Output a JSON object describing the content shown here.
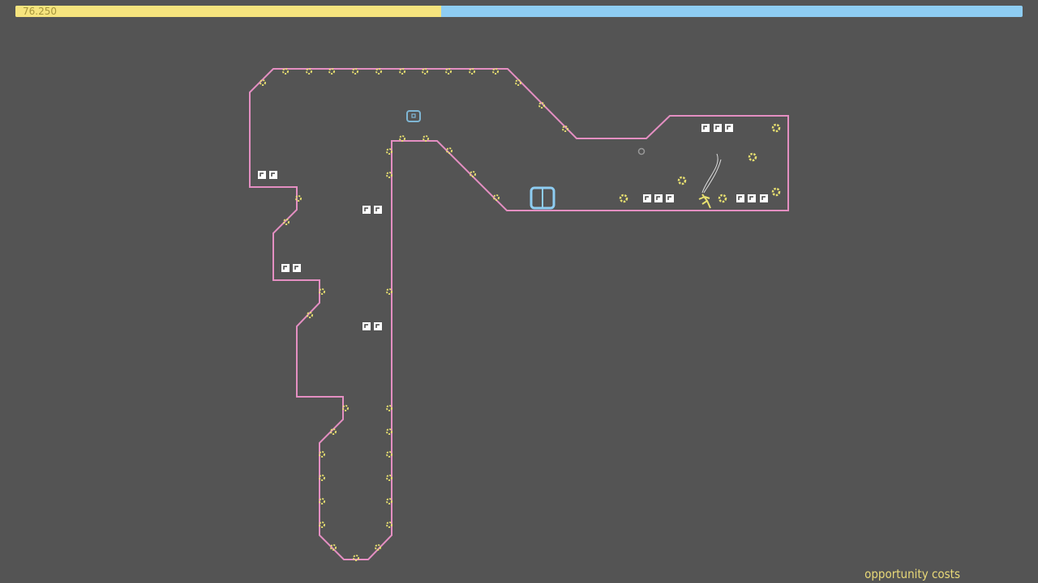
{
  "hud": {
    "timer": "76.250",
    "time_remaining_fraction": 0.423
  },
  "level": {
    "name": "opportunity costs"
  },
  "colors": {
    "background": "#545454",
    "wall_outline": "#e48fc2",
    "gold": "#e8e070",
    "time_bar_fill": "#f6e47e",
    "time_bar_empty": "#8ecdf2",
    "door": "#8ecdf2"
  }
}
